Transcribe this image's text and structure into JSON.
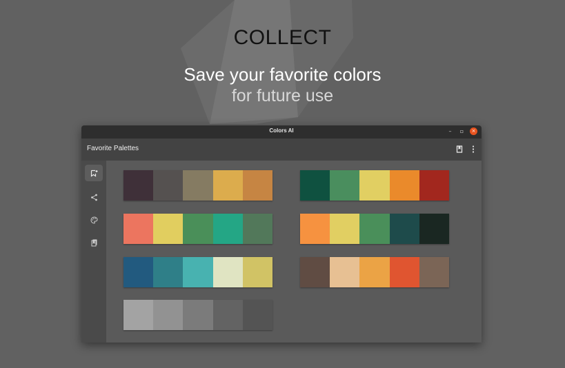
{
  "hero": {
    "title": "COLLECT",
    "subtitle_line1": "Save your favorite colors",
    "subtitle_line2": "for future use"
  },
  "window": {
    "title": "Colors AI",
    "controls": {
      "minimize": "–",
      "maximize": "▫",
      "close": "×"
    }
  },
  "headerbar": {
    "title": "Favorite Palettes",
    "actions": [
      "bookmarks-icon",
      "more-vertical-icon"
    ]
  },
  "sidebar": {
    "items": [
      {
        "name": "collect-icon",
        "active": true
      },
      {
        "name": "share-icon",
        "active": false
      },
      {
        "name": "palette-icon",
        "active": false
      },
      {
        "name": "bookmark-icon",
        "active": false
      }
    ]
  },
  "palettes": [
    [
      "#3f3039",
      "#555150",
      "#857b62",
      "#dcac4d",
      "#c68543"
    ],
    [
      "#0f5140",
      "#4a8e5e",
      "#e1cf62",
      "#ea8a2b",
      "#a2271e"
    ],
    [
      "#ec755f",
      "#e1ce5f",
      "#4a8f59",
      "#24a685",
      "#52785a"
    ],
    [
      "#f69240",
      "#e1cf62",
      "#4a8f5a",
      "#1e4b4b",
      "#1a2722"
    ],
    [
      "#225a7f",
      "#2f7f88",
      "#48b2b0",
      "#e0e4c2",
      "#d1c365"
    ],
    [
      "#604c43",
      "#e7c093",
      "#eba345",
      "#e05530",
      "#7b6556"
    ],
    [
      "#a3a3a3",
      "#929292",
      "#7b7b7b",
      "#636363",
      "#545454"
    ]
  ]
}
